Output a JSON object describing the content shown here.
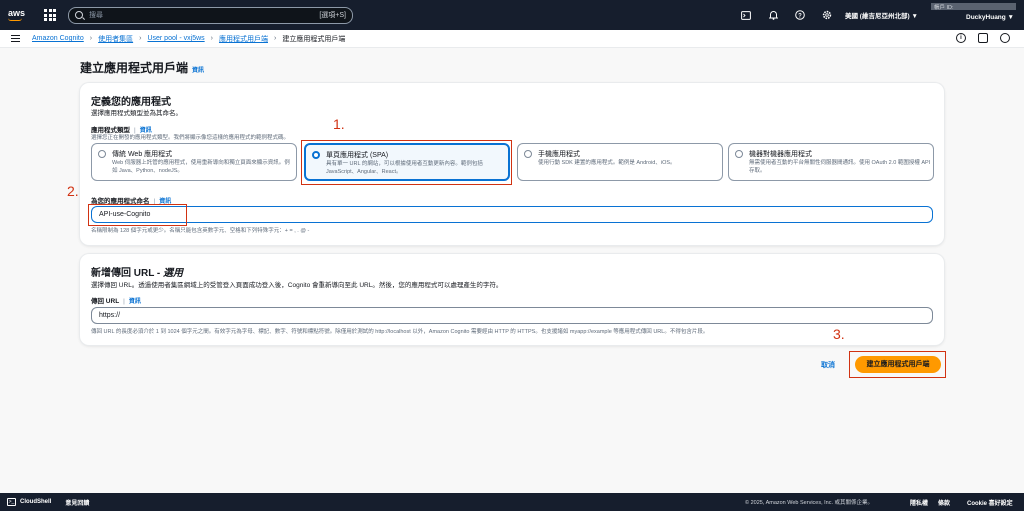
{
  "topnav": {
    "logo": "aws",
    "search_placeholder": "搜尋",
    "search_shortcut": "[選項+S]",
    "icons": [
      "cloudshell-icon",
      "bell-icon",
      "help-icon",
      "settings-icon"
    ],
    "region": "美國 (維吉尼亞州北部) ▼",
    "account_label": "帳戶 ID: ",
    "user": "DuckyHuang ▼"
  },
  "breadcrumb": {
    "items": [
      "Amazon Cognito",
      "使用者集區",
      "User pool - vxj5ws",
      "應用程式用戶端"
    ],
    "current": "建立應用程式用戶端"
  },
  "page": {
    "title": "建立應用程式用戶端",
    "info": "資訊"
  },
  "panel1": {
    "heading": "定義您的應用程式",
    "subheading": "選擇應用程式類型並為其命名。",
    "type_label": "應用程式類型",
    "type_info": "資訊",
    "type_desc": "選擇您正在開發的應用程式類型。我們將顯示像您這樣的應用程式的範例程式碼。",
    "tiles": [
      {
        "title": "傳統 Web 應用程式",
        "desc": "Web 伺服器上託管的應用程式，使用重新導向和獨立頁面來顯示資訊。例如 Java、Python、nodeJS。"
      },
      {
        "title": "單頁應用程式 (SPA)",
        "desc": "具有單一 URL 的網站，可以根據使用者互動更新內容。範例包括 JavaScript、Angular、React。"
      },
      {
        "title": "手機應用程式",
        "desc": "使用行動 SDK 建置的應用程式。範例是 Android、iOS。"
      },
      {
        "title": "機器對機器應用程式",
        "desc": "無需使用者互動的平台無關性伺服器間通訊。使用 OAuth 2.0 範圍授權 API 存取。"
      }
    ],
    "selected_index": 1,
    "name_label": "為您的應用程式命名",
    "name_info": "資訊",
    "name_value": "API-use-Cognito",
    "name_help": "名稱限制為 128 個字元或更少。名稱只能包含英數字元、空格和下列特殊字元：+ = , . @ -"
  },
  "panel2": {
    "heading": "新增傳回 URL - ",
    "heading_optional": "選用",
    "subheading": "選擇傳回 URL。透過使用者集區網域上的受管登入頁面成功登入後，Cognito 會重新導向至此 URL。然後，您的應用程式可以處理產生的字符。",
    "url_label": "傳回 URL",
    "url_info": "資訊",
    "url_value": "https://",
    "url_help": "傳回 URL 的長度必須介於 1 到 1024 個字元之間。有效字元為字母、標記、數字、符號和標點符號。除僅用於測試的 http://localhost 以外，Amazon Cognito 需要經由 HTTP 的 HTTPS。也支援諸如 myapp://example 等應用程式傳回 URL。不得包含片段。"
  },
  "actions": {
    "cancel": "取消",
    "create": "建立應用程式用戶端"
  },
  "annotations": {
    "a1": "1.",
    "a2": "2.",
    "a3": "3.",
    "color": "#d13212"
  },
  "footer": {
    "cloudshell": "CloudShell",
    "feedback": "意見回饋",
    "copyright": "© 2025, Amazon Web Services, Inc. 或其關係企業。",
    "privacy": "隱私權",
    "terms": "條款",
    "cookie": "Cookie 喜好設定"
  },
  "colors": {
    "nav_bg": "#161e2d",
    "link": "#0972d3",
    "primary_button": "#ff9900"
  }
}
